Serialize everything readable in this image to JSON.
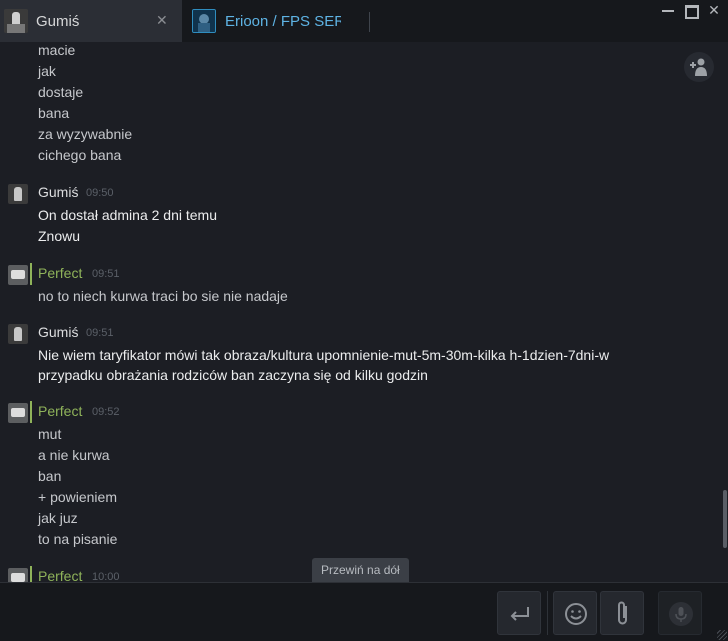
{
  "tabs": [
    {
      "label": "Gumiś",
      "close": "✕"
    },
    {
      "label": "Erioon / FPS SERVI"
    }
  ],
  "window_controls": {
    "minimize": "—",
    "maximize": "☐",
    "close": "✕"
  },
  "add_friend_icon": "+👤",
  "messages_top": [
    {
      "text": "macie"
    },
    {
      "text": "jak"
    },
    {
      "text": "dostaje"
    },
    {
      "text": "bana"
    },
    {
      "text": "za wyzywabnie"
    },
    {
      "text": "cichego bana"
    }
  ],
  "groups": [
    {
      "sender": "Gumiś",
      "time": "09:50",
      "lines": [
        "On dostał admina 2 dni temu",
        "Znowu"
      ]
    },
    {
      "sender": "Perfect",
      "time": "09:51",
      "lines": [
        "no to niech kurwa traci bo sie nie nadaje"
      ]
    },
    {
      "sender": "Gumiś",
      "time": "09:51",
      "lines": [
        "Nie wiem taryfikator mówi tak obraza/kultura upomnienie-mut-5m-30m-kilka h-1dzien-7dni-w",
        "przypadku obrażania rodziców ban zaczyna się od kilku godzin"
      ]
    },
    {
      "sender": "Perfect",
      "time": "09:52",
      "lines": [
        "mut",
        "a nie kurwa",
        "ban",
        "+ powieniem",
        "jak juz",
        "to na pisanie"
      ]
    },
    {
      "sender": "Perfect",
      "time": "10:00",
      "lines": []
    }
  ],
  "scroll_to_bottom": "Przewiń na dół",
  "composer": {
    "placeholder": "",
    "send_icon": "↵",
    "emoji_icon": "☺",
    "attach_icon": "📎",
    "voice_icon": "🎙"
  },
  "colors": {
    "background": "#1c1e24",
    "friend_green": "#8fb35a",
    "tab_accent": "#5eb3e4"
  }
}
